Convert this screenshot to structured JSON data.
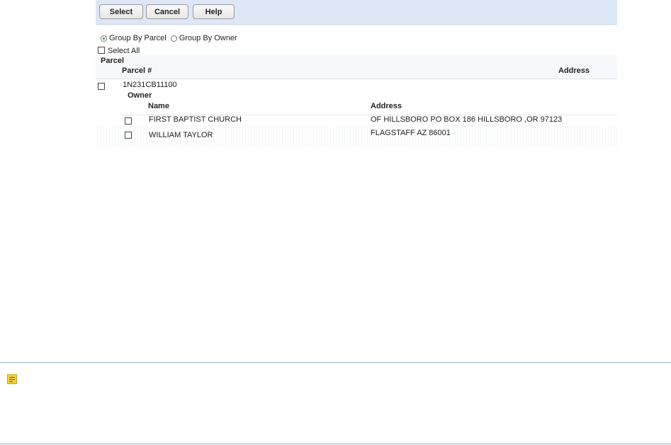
{
  "toolbar": {
    "select_label": "Select",
    "cancel_label": "Cancel",
    "help_label": "Help",
    "background": "#dde8f6"
  },
  "grouping": {
    "options": [
      "Group By Parcel",
      "Group By Owner"
    ],
    "selected": "Group By Parcel"
  },
  "select_all_label": "Select All",
  "grid": {
    "group_title": "Parcel",
    "columns": [
      "Parcel #",
      "Address"
    ],
    "parcels": [
      {
        "parcel_number": "1N231CB11100",
        "address": "",
        "owner_section_title": "Owner",
        "owner_columns": [
          "Name",
          "Address"
        ],
        "owners": [
          {
            "name": "FIRST BAPTIST CHURCH",
            "address": "OF HILLSBORO PO BOX 186 HILLSBORO ,OR 97123"
          },
          {
            "name": "WILLIAM TAYLOR",
            "address": "FLAGSTAFF AZ 86001"
          }
        ]
      }
    ]
  },
  "note": {
    "icon": "note-icon",
    "border_color": "#8fb6c6"
  }
}
